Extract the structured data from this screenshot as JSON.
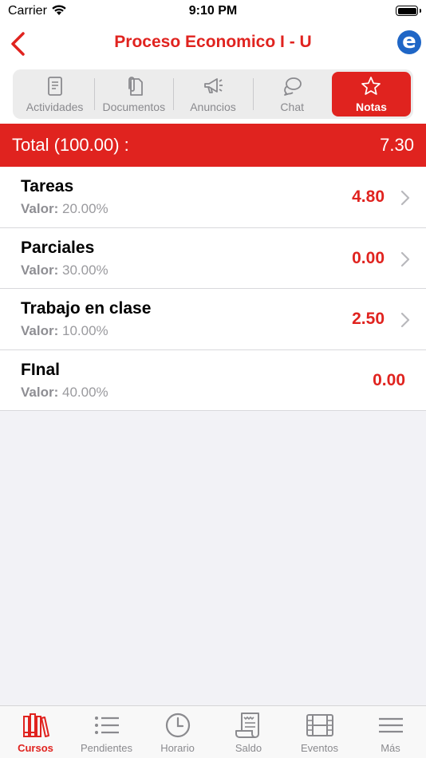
{
  "status": {
    "carrier": "Carrier",
    "time": "9:10 PM"
  },
  "nav": {
    "title": "Proceso Economico I - U",
    "brand_letter": "e"
  },
  "tabs": [
    {
      "label": "Actividades",
      "icon": "document-icon",
      "active": false
    },
    {
      "label": "Documentos",
      "icon": "paperclip-document-icon",
      "active": false
    },
    {
      "label": "Anuncios",
      "icon": "megaphone-icon",
      "active": false
    },
    {
      "label": "Chat",
      "icon": "chat-bubbles-icon",
      "active": false
    },
    {
      "label": "Notas",
      "icon": "star-icon",
      "active": true
    }
  ],
  "total": {
    "label": "Total (100.00) :",
    "value": "7.30"
  },
  "grades": [
    {
      "name": "Tareas",
      "weight_label": "Valor:",
      "weight": "20.00%",
      "score": "4.80",
      "has_detail": true
    },
    {
      "name": "Parciales",
      "weight_label": "Valor:",
      "weight": "30.00%",
      "score": "0.00",
      "has_detail": true
    },
    {
      "name": "Trabajo en clase",
      "weight_label": "Valor:",
      "weight": "10.00%",
      "score": "2.50",
      "has_detail": true
    },
    {
      "name": "FInal",
      "weight_label": "Valor:",
      "weight": "40.00%",
      "score": "0.00",
      "has_detail": false
    }
  ],
  "bottom_tabs": [
    {
      "label": "Cursos",
      "icon": "books-icon",
      "active": true
    },
    {
      "label": "Pendientes",
      "icon": "list-icon",
      "active": false
    },
    {
      "label": "Horario",
      "icon": "clock-icon",
      "active": false
    },
    {
      "label": "Saldo",
      "icon": "receipt-icon",
      "active": false
    },
    {
      "label": "Eventos",
      "icon": "film-strip-icon",
      "active": false
    },
    {
      "label": "Más",
      "icon": "menu-icon",
      "active": false
    }
  ],
  "colors": {
    "accent": "#e0231f",
    "brand_blue": "#1f66c6",
    "inactive": "#8a8a8e"
  }
}
